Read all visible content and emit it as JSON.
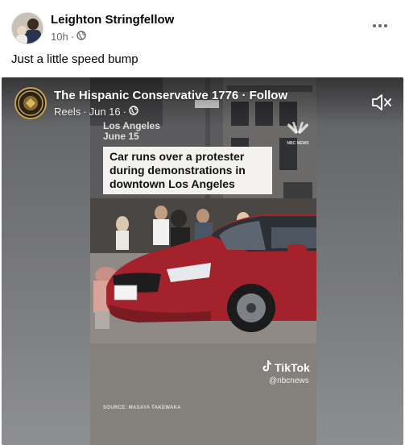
{
  "post": {
    "author": "Leighton Stringfellow",
    "time": "10h",
    "separator": "·",
    "caption": "Just a little speed bump"
  },
  "reel": {
    "page_name": "The Hispanic Conservative 1776",
    "follow_sep": "·",
    "follow_label": "Follow",
    "type": "Reels",
    "date": "Jun 16",
    "video": {
      "location": "Los Angeles",
      "date": "June 15",
      "headline": "Car runs over a protester during demonstrations in downtown Los Angeles",
      "tiktok_label": "TikTok",
      "tiktok_handle": "@nbcnews",
      "source": "SOURCE: MASAYA TAKEWAKA",
      "nbc_label": "NBC NEWS"
    }
  },
  "colors": {
    "meta_gray": "#65676b",
    "car_red": "#a3222b",
    "text_dark": "#050505"
  },
  "icons": [
    "globe-icon",
    "more-options-icon",
    "mute-icon",
    "tiktok-icon",
    "nbc-peacock-icon"
  ]
}
